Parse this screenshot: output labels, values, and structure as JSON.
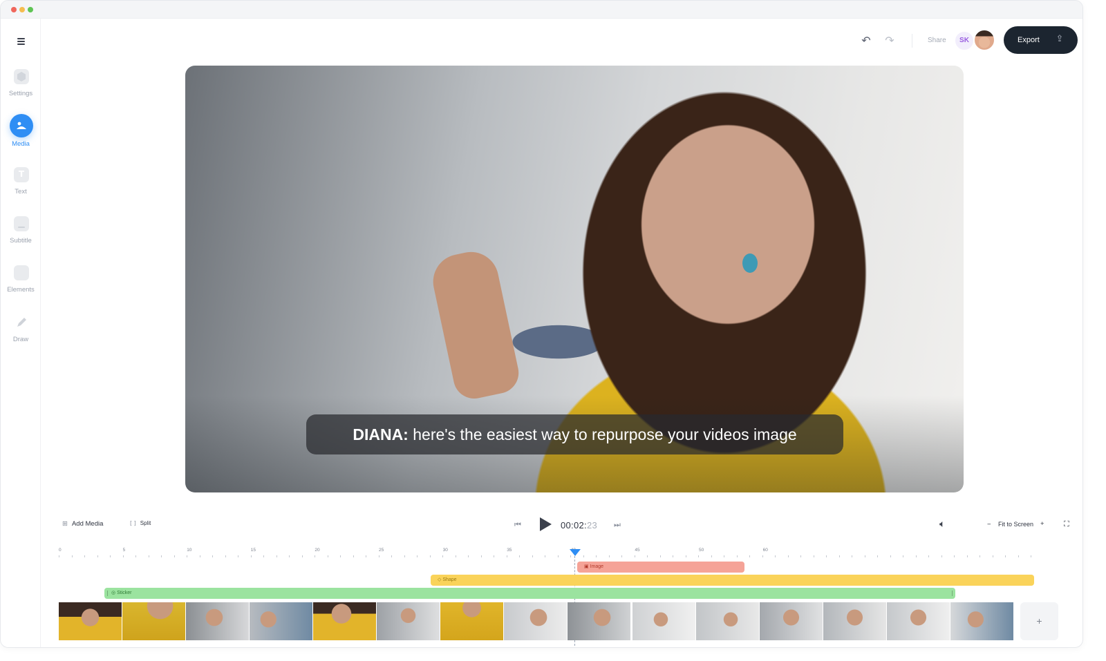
{
  "sidebar": {
    "items": [
      {
        "label": "Settings",
        "icon": "gear-icon"
      },
      {
        "label": "Media",
        "icon": "media-icon",
        "active": true
      },
      {
        "label": "Text",
        "icon": "text-icon"
      },
      {
        "label": "Subtitle",
        "icon": "subtitle-icon"
      },
      {
        "label": "Elements",
        "icon": "elements-icon"
      },
      {
        "label": "Draw",
        "icon": "pencil-icon"
      }
    ]
  },
  "topbar": {
    "share_label": "Share",
    "avatar_initials": "SK",
    "export_label": "Export",
    "icons": [
      "undo-icon",
      "redo-icon",
      "upload-icon"
    ]
  },
  "video": {
    "caption_speaker": "DIANA:",
    "caption_text": " here's the easiest way to repurpose your videos image"
  },
  "timeline": {
    "add_media_label": "Add Media",
    "split_label": "Split",
    "time_main": "00:02:",
    "time_frames": "23",
    "fit_label": "Fit to Screen",
    "ruler_labels": [
      "0",
      "5",
      "10",
      "15",
      "20",
      "25",
      "30",
      "35",
      "40",
      "45",
      "50",
      "60"
    ],
    "tracks": {
      "image": "Image",
      "shape": "Shape",
      "sticker": "Sticker"
    },
    "add_clip_symbol": "+"
  },
  "colors": {
    "accent": "#2f8ef4",
    "export_bg": "#1c2530",
    "track_image": "#f5a397",
    "track_shape": "#fad35a",
    "track_sticker": "#9be39f"
  }
}
